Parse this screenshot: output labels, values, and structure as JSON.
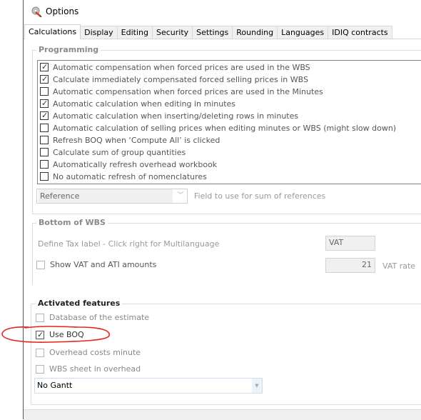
{
  "window": {
    "title": "Options",
    "icon": "options-gear-pencil-icon"
  },
  "tabs": [
    {
      "label": "Calculations",
      "active": true
    },
    {
      "label": "Display",
      "active": false
    },
    {
      "label": "Editing",
      "active": false
    },
    {
      "label": "Security",
      "active": false
    },
    {
      "label": "Settings",
      "active": false
    },
    {
      "label": "Rounding",
      "active": false
    },
    {
      "label": "Languages",
      "active": false
    },
    {
      "label": "IDIQ contracts",
      "active": false
    }
  ],
  "programming": {
    "legend": "Programming",
    "items": [
      {
        "label": "Automatic compensation when forced prices are used in the WBS",
        "checked": true
      },
      {
        "label": "Calculate immediately compensated forced selling prices in WBS",
        "checked": true
      },
      {
        "label": "Automatic compensation when forced prices are used in the Minutes",
        "checked": false
      },
      {
        "label": "Automatic calculation when editing in minutes",
        "checked": true
      },
      {
        "label": "Automatic calculation when inserting/deleting rows in minutes",
        "checked": true
      },
      {
        "label": "Automatic calculation of selling prices when editing minutes or WBS (might slow down)",
        "checked": false
      },
      {
        "label": "Refresh BOQ when ‘Compute All’ is clicked",
        "checked": false
      },
      {
        "label": "Calculate sum of group quantities",
        "checked": false
      },
      {
        "label": "Automatically refresh overhead workbook",
        "checked": false
      },
      {
        "label": "No automatic refresh of nomenclatures",
        "checked": false
      }
    ],
    "reference_field": {
      "value": "Reference",
      "label": "Field to use for sum of references"
    }
  },
  "bottom_wbs": {
    "legend": "Bottom of WBS",
    "tax_label_caption": "Define Tax label - Click right for Multilanguage",
    "tax_label_value": "VAT",
    "show_vat": {
      "label": "Show VAT and ATI amounts",
      "checked": false
    },
    "vat_rate_value": "21",
    "vat_rate_label": "VAT rate"
  },
  "activated_features": {
    "legend": "Activated features",
    "items": [
      {
        "label": "Database of the estimate",
        "checked": false
      },
      {
        "label": "Use BOQ",
        "checked": true
      },
      {
        "label": "Overhead costs minute",
        "checked": false
      },
      {
        "label": "WBS sheet in overhead",
        "checked": false
      }
    ],
    "gantt_select": {
      "value": "No Gantt"
    }
  },
  "annotation": {
    "color": "#e8231b",
    "target": "Use BOQ"
  },
  "colors": {
    "annotation_red": "#e8231b",
    "tab_bg": "#f0f0f0"
  }
}
